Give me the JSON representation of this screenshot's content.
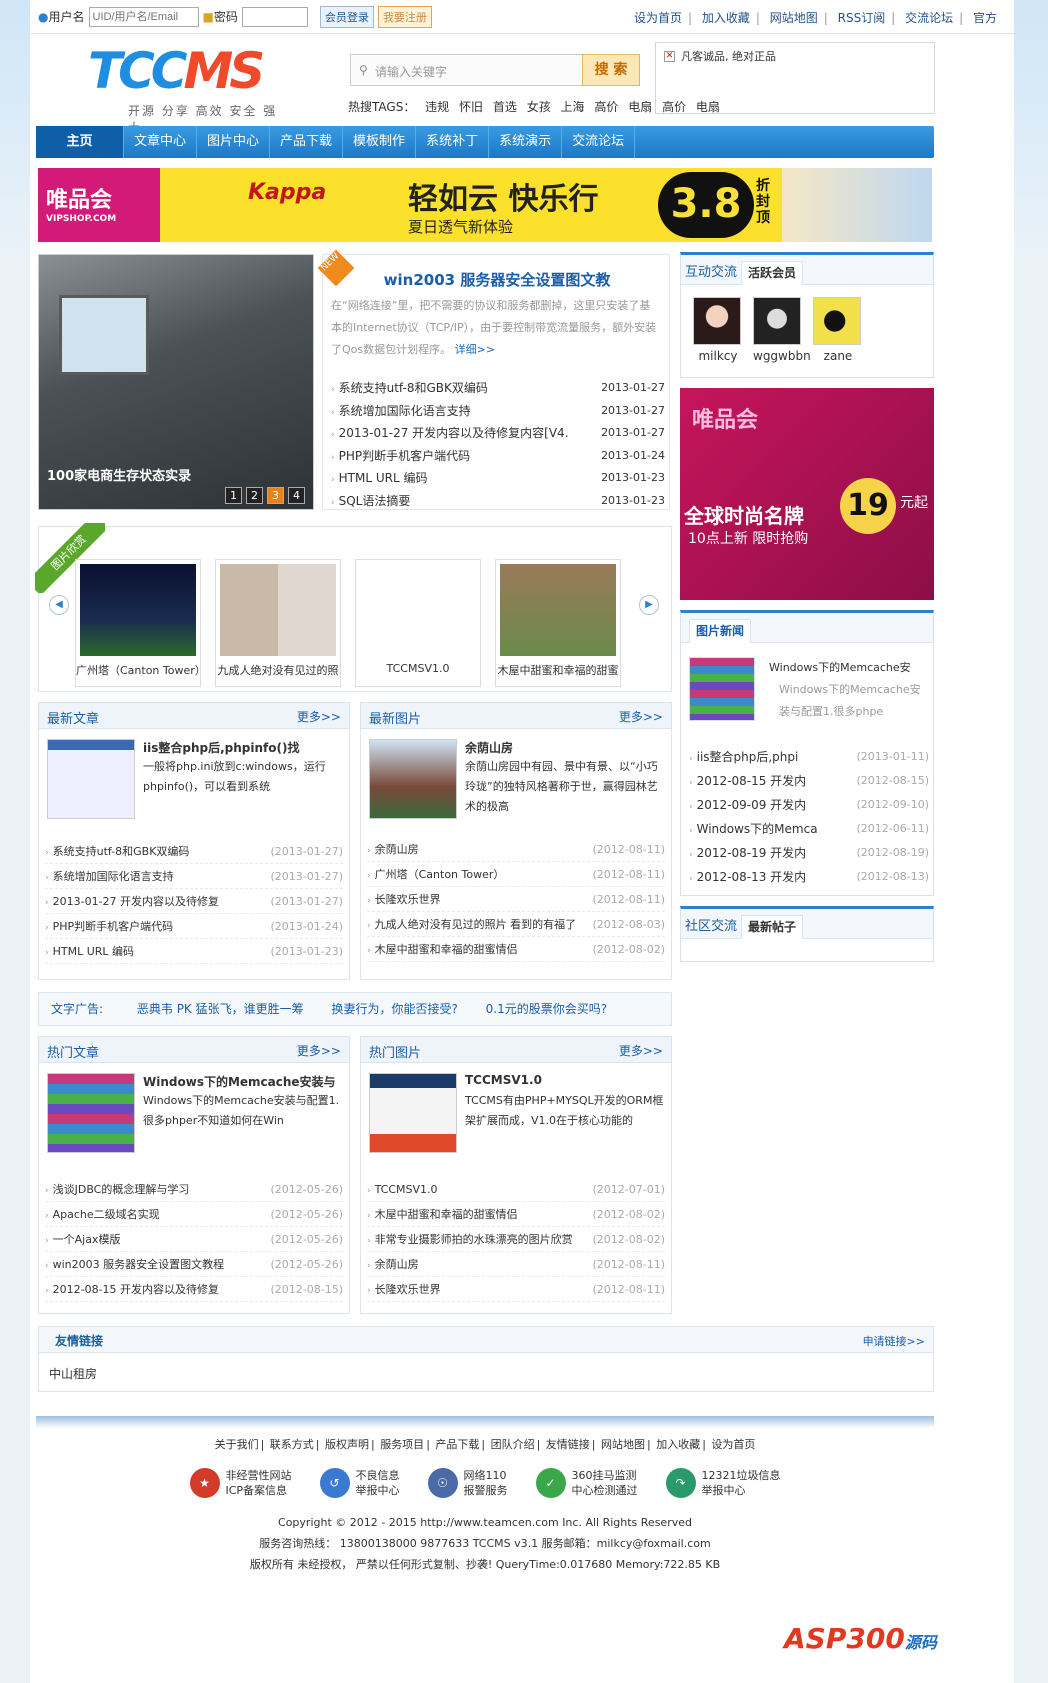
{
  "topbar": {
    "user_label": "用户名",
    "user_ph": "UID/用户名/Email",
    "pwd_label": "密码",
    "login": "会员登录",
    "register": "我要注册",
    "links": [
      "设为首页",
      "加入收藏",
      "网站地图",
      "RSS订阅",
      "交流论坛",
      "官方"
    ]
  },
  "logo": {
    "tc": "TCC",
    "ms": "MS",
    "slogan": "开源 分享 高效 安全 强大"
  },
  "search": {
    "placeholder": "请输入关键字",
    "button": "搜 索",
    "hot_label": "热搜TAGS：",
    "tags": [
      "违规",
      "怀旧",
      "首选",
      "女孩",
      "上海",
      "高价",
      "电扇",
      "高价",
      "电扇"
    ]
  },
  "notice": {
    "text": "凡客诚品, 绝对正品"
  },
  "nav": [
    "主页",
    "文章中心",
    "图片中心",
    "产品下载",
    "模板制作",
    "系统补丁",
    "系统演示",
    "交流论坛"
  ],
  "banner": {
    "vip": "唯品会",
    "vip_url": "VIPSHOP.COM",
    "kappa": "Kappa",
    "slogan1": "轻如云 快乐行",
    "slogan2": "夏日透气新体验",
    "price": "3.8",
    "zhe": "折封顶"
  },
  "focus": {
    "caption": "100家电商生存状态实录",
    "nums": [
      "1",
      "2",
      "3",
      "4"
    ]
  },
  "headline": {
    "new": "NEW",
    "title": "win2003 服务器安全设置图文教",
    "desc": "在“网络连接”里，把不需要的协议和服务都删掉，这里只安装了基本的Internet协议（TCP/IP），由于要控制带宽流量服务，额外安装了Qos数据包计划程序。",
    "more": "详细>>",
    "list": [
      [
        "系统支持utf-8和GBK双编码",
        "2013-01-27"
      ],
      [
        "系统增加国际化语言支持",
        "2013-01-27"
      ],
      [
        "2013-01-27 开发内容以及待修复内容[V4.",
        "2013-01-27"
      ],
      [
        "PHP判断手机客户端代码",
        "2013-01-24"
      ],
      [
        "HTML URL 编码",
        "2013-01-23"
      ],
      [
        "SQL语法摘要",
        "2013-01-23"
      ]
    ]
  },
  "community": {
    "title": "互动交流",
    "tab": "活跃会员",
    "members": [
      "milkcy",
      "wggwbbn",
      "zane"
    ]
  },
  "ad2": {
    "vip": "唯品会",
    "t1": "全球时尚名牌",
    "t2": "10点上新 限时抢购",
    "price": "19",
    "unit": "元起"
  },
  "picshow": {
    "tag": "图片欣赏",
    "items": [
      "广州塔（Canton Tower）",
      "九成人绝对没有见过的照",
      "TCCMSV1.0",
      "木屋中甜蜜和幸福的甜蜜"
    ]
  },
  "latest_articles": {
    "title": "最新文章",
    "more": "更多>>",
    "feat_title": "iis整合php后,phpinfo()找",
    "feat_desc": "一般将php.ini放到c:windows，运行phpinfo()，可以看到系统",
    "list": [
      [
        "系统支持utf-8和GBK双编码",
        "(2013-01-27)"
      ],
      [
        "系统增加国际化语言支持",
        "(2013-01-27)"
      ],
      [
        "2013-01-27 开发内容以及待修复",
        "(2013-01-27)"
      ],
      [
        "PHP判断手机客户端代码",
        "(2013-01-24)"
      ],
      [
        "HTML URL 编码",
        "(2013-01-23)"
      ]
    ]
  },
  "latest_pics": {
    "title": "最新图片",
    "more": "更多>>",
    "feat_title": "余荫山房",
    "feat_desc": "余荫山房园中有园、景中有景、以“小巧玲珑”的独特风格著称于世，赢得园林艺术的极高",
    "list": [
      [
        "余荫山房",
        "(2012-08-11)"
      ],
      [
        "广州塔（Canton Tower）",
        "(2012-08-11)"
      ],
      [
        "长隆欢乐世界",
        "(2012-08-11)"
      ],
      [
        "九成人绝对没有见过的照片 看到的有福了",
        "(2012-08-03)"
      ],
      [
        "木屋中甜蜜和幸福的甜蜜情侣",
        "(2012-08-02)"
      ]
    ]
  },
  "pic_news": {
    "title": "图片新闻",
    "feat_title": "Windows下的Memcache安",
    "feat_desc": "Windows下的Memcache安装与配置1.很多phpe",
    "list": [
      [
        "iis整合php后,phpi",
        "(2013-01-11)"
      ],
      [
        "2012-08-15 开发内",
        "(2012-08-15)"
      ],
      [
        "2012-09-09 开发内",
        "(2012-09-10)"
      ],
      [
        "Windows下的Memca",
        "(2012-06-11)"
      ],
      [
        "2012-08-19 开发内",
        "(2012-08-19)"
      ],
      [
        "2012-08-13 开发内",
        "(2012-08-13)"
      ]
    ]
  },
  "forum": {
    "title": "社区交流",
    "tab": "最新帖子"
  },
  "adtext": {
    "label": "文字广告:",
    "items": [
      "恶典韦 PK 猛张飞，谁更胜一筹",
      "换妻行为，你能否接受?",
      "0.1元的股票你会买吗?"
    ]
  },
  "hot_articles": {
    "title": "热门文章",
    "more": "更多>>",
    "feat_title": "Windows下的Memcache安装与",
    "feat_desc": "Windows下的Memcache安装与配置1.很多phper不知道如何在Win",
    "list": [
      [
        "浅谈JDBC的概念理解与学习",
        "(2012-05-26)"
      ],
      [
        "Apache二级域名实现",
        "(2012-05-26)"
      ],
      [
        "一个Ajax模版",
        "(2012-05-26)"
      ],
      [
        "win2003 服务器安全设置图文教程",
        "(2012-05-26)"
      ],
      [
        "2012-08-15 开发内容以及待修复",
        "(2012-08-15)"
      ]
    ]
  },
  "hot_pics": {
    "title": "热门图片",
    "more": "更多>>",
    "feat_title": "TCCMSV1.0",
    "feat_desc": "TCCMS有由PHP+MYSQL开发的ORM框架扩展而成，V1.0在于核心功能的",
    "list": [
      [
        "TCCMSV1.0",
        "(2012-07-01)"
      ],
      [
        "木屋中甜蜜和幸福的甜蜜情侣",
        "(2012-08-02)"
      ],
      [
        "非常专业摄影师拍的水珠漂亮的图片欣赏",
        "(2012-08-02)"
      ],
      [
        "余荫山房",
        "(2012-08-11)"
      ],
      [
        "长隆欢乐世界",
        "(2012-08-11)"
      ]
    ]
  },
  "friend": {
    "title": "友情链接",
    "apply": "申请链接>>",
    "link": "中山租房"
  },
  "footer": {
    "links": [
      "关于我们",
      "联系方式",
      "版权声明",
      "服务项目",
      "产品下载",
      "团队介绍",
      "友情链接",
      "网站地图",
      "加入收藏",
      "设为首页"
    ],
    "badges": [
      [
        "非经营性网站",
        "ICP备案信息"
      ],
      [
        "不良信息",
        "举报中心"
      ],
      [
        "网络110",
        "报警服务"
      ],
      [
        "360挂马监测",
        "中心检测通过"
      ],
      [
        "12321垃圾信息",
        "举报中心"
      ]
    ],
    "copyright": "Copyright © 2012 - 2015 http://www.teamcen.com Inc. All Rights Reserved",
    "contact": "服务咨询热线： 13800138000    9877633 TCCMS v3.1 服务邮箱：milkcy@foxmail.com",
    "rights": "版权所有 未经授权， 严禁以任何形式复制、抄袭!    QueryTime:0.017680 Memory:722.85 KB",
    "asp": "ASP300",
    "asp2": "源码"
  }
}
